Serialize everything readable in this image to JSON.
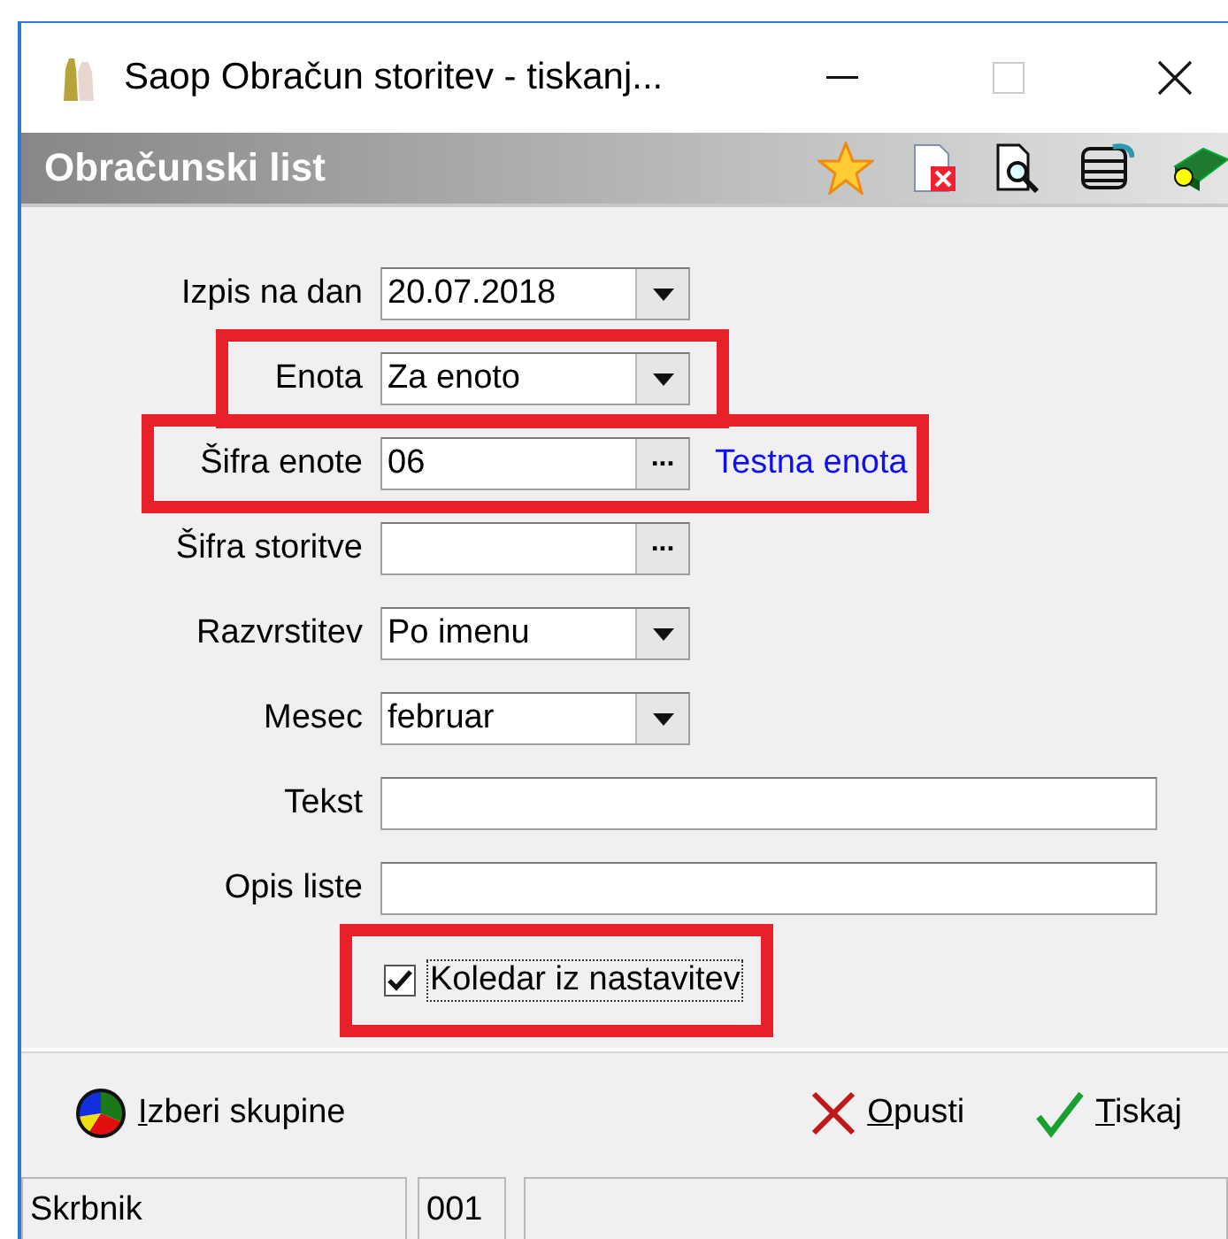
{
  "window": {
    "title": "Saop Obračun storitev - tiskanj..."
  },
  "header": {
    "title": "Obračunski list"
  },
  "fields": [
    {
      "kind": "combo",
      "label": "Izpis na dan",
      "value": "20.07.2018",
      "highlighted": false
    },
    {
      "kind": "combo",
      "label": "Enota",
      "value": "Za enoto",
      "highlighted": true
    },
    {
      "kind": "lookup",
      "label": "Šifra enote",
      "value": "06",
      "button_label": "...",
      "description": "Testna enota",
      "highlighted": true
    },
    {
      "kind": "lookup",
      "label": "Šifra storitve",
      "button_label": "...",
      "highlighted": false
    },
    {
      "kind": "combo",
      "label": "Razvrstitev",
      "value": "Po imenu",
      "highlighted": false
    },
    {
      "kind": "combo",
      "label": "Mesec",
      "value": "februar",
      "highlighted": false
    },
    {
      "kind": "text",
      "label": "Tekst",
      "highlighted": false
    },
    {
      "kind": "text",
      "label": "Opis liste",
      "highlighted": false
    }
  ],
  "checkbox": {
    "label": "Koledar iz nastavitev",
    "checked": true,
    "focused": true,
    "highlighted": true
  },
  "buttons": [
    {
      "kind": "groups",
      "label": "Izberi skupine"
    },
    {
      "kind": "cancel",
      "label": "Opusti"
    },
    {
      "kind": "print",
      "label": "Tiskaj"
    }
  ],
  "status_bar": [
    "Skrbnik",
    "001"
  ]
}
